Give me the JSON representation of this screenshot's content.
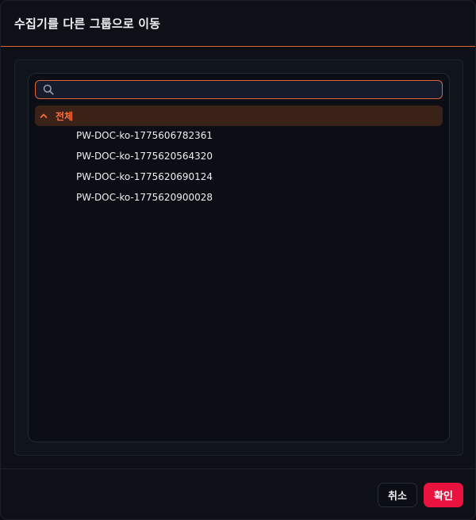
{
  "dialog": {
    "title": "수집기를 다른 그룹으로 이동"
  },
  "search": {
    "value": "",
    "placeholder": ""
  },
  "tree": {
    "root_label": "전체",
    "expanded": true,
    "children": [
      {
        "label": "PW-DOC-ko-1775606782361"
      },
      {
        "label": "PW-DOC-ko-1775620564320"
      },
      {
        "label": "PW-DOC-ko-1775620690124"
      },
      {
        "label": "PW-DOC-ko-1775620900028"
      }
    ]
  },
  "footer": {
    "cancel_label": "취소",
    "confirm_label": "확인"
  },
  "colors": {
    "accent": "#e0643a",
    "tree_root_text": "#ff6f3c",
    "tree_root_bg": "#3a2219",
    "confirm_bg": "#e8133f",
    "background": "#0d1016"
  },
  "icons": {
    "search": "search-icon",
    "expand": "chevron-up-icon"
  }
}
